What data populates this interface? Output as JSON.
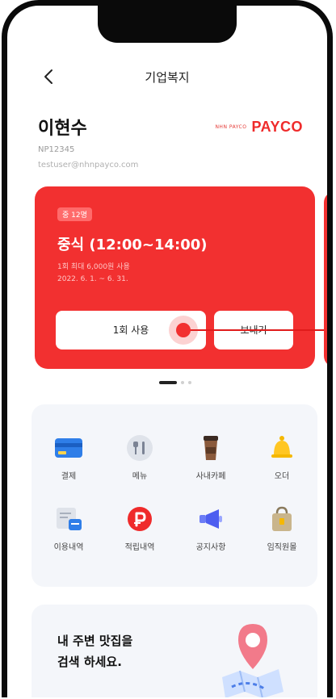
{
  "header": {
    "title": "기업복지",
    "back_icon": "chevron-left-icon"
  },
  "user": {
    "name": "이현수",
    "employee_id": "NP12345",
    "email": "testuser@nhnpayco.com"
  },
  "brand": {
    "sub": "NHN PAYCO",
    "name": "PAYCO",
    "color": "#ef2b2b"
  },
  "meal_card": {
    "badge": "중 12명",
    "title": "중식 (12:00~14:00)",
    "limit": "1회 최대 6,000원 사용",
    "period": "2022. 6. 1. ~ 6. 31.",
    "use_label": "1회 사용",
    "send_label": "보내기",
    "color": "#f23030"
  },
  "carousel": {
    "pages": 3,
    "active": 0
  },
  "menu": {
    "items": [
      {
        "label": "결제",
        "icon": "card-icon"
      },
      {
        "label": "메뉴",
        "icon": "utensils-icon"
      },
      {
        "label": "사내카페",
        "icon": "coffee-cup-icon"
      },
      {
        "label": "오더",
        "icon": "bell-icon"
      },
      {
        "label": "이용내역",
        "icon": "receipt-icon"
      },
      {
        "label": "적립내역",
        "icon": "point-icon"
      },
      {
        "label": "공지사항",
        "icon": "megaphone-icon"
      },
      {
        "label": "임직원몰",
        "icon": "shopping-bag-icon"
      }
    ]
  },
  "promo": {
    "line1": "내 주변 맛집을",
    "line2": "검색 하세요.",
    "icon": "map-pin-icon"
  }
}
